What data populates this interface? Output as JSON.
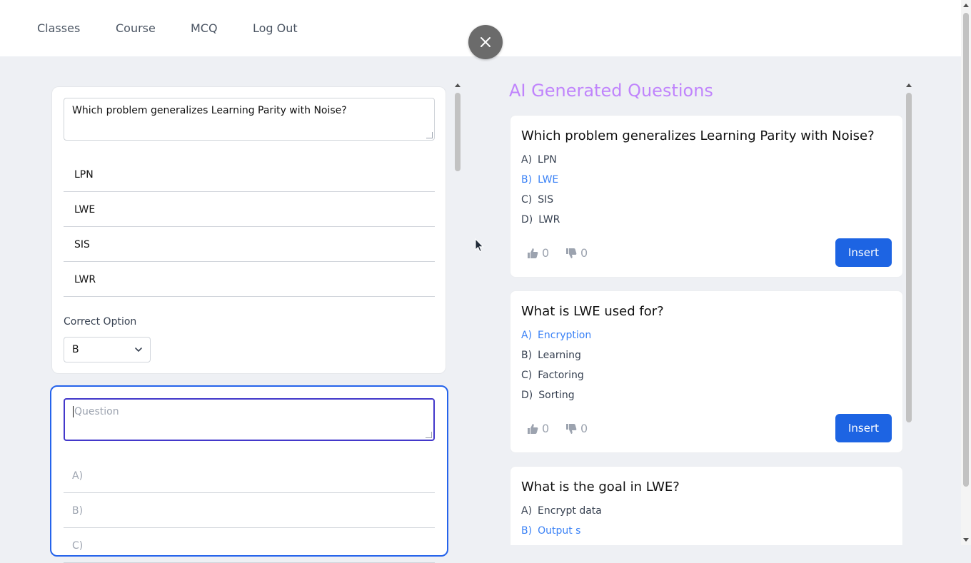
{
  "nav": {
    "items": [
      {
        "label": "Classes"
      },
      {
        "label": "Course"
      },
      {
        "label": "MCQ"
      },
      {
        "label": "Log Out"
      }
    ]
  },
  "close_icon": "close-icon",
  "editor": {
    "card1": {
      "question": "Which problem generalizes Learning Parity with Noise?",
      "options": [
        "LPN",
        "LWE",
        "SIS",
        "LWR"
      ],
      "correct_label": "Correct Option",
      "correct_value": "B"
    },
    "card2": {
      "question_placeholder": "Question",
      "option_placeholders": [
        "A)",
        "B)",
        "C)"
      ]
    }
  },
  "ai": {
    "title": "AI Generated Questions",
    "insert_label": "Insert",
    "questions": [
      {
        "title": "Which problem generalizes Learning Parity with Noise?",
        "options": [
          {
            "letter": "A)",
            "text": "LPN"
          },
          {
            "letter": "B)",
            "text": "LWE"
          },
          {
            "letter": "C)",
            "text": "SIS"
          },
          {
            "letter": "D)",
            "text": "LWR"
          }
        ],
        "correct": 1,
        "likes": "0",
        "dislikes": "0"
      },
      {
        "title": "What is LWE used for?",
        "options": [
          {
            "letter": "A)",
            "text": "Encryption"
          },
          {
            "letter": "B)",
            "text": "Learning"
          },
          {
            "letter": "C)",
            "text": "Factoring"
          },
          {
            "letter": "D)",
            "text": "Sorting"
          }
        ],
        "correct": 0,
        "likes": "0",
        "dislikes": "0"
      },
      {
        "title": "What is the goal in LWE?",
        "options": [
          {
            "letter": "A)",
            "text": "Encrypt data"
          },
          {
            "letter": "B)",
            "text": "Output s"
          }
        ],
        "correct": 1
      }
    ]
  },
  "colors": {
    "accent": "#1d64e3",
    "ai_title": "#c084fc",
    "correct_option": "#3b82f6",
    "active_border": "#2563eb"
  }
}
